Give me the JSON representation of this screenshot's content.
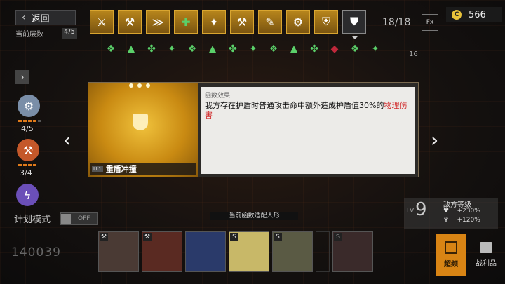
{
  "header": {
    "back_label": "返回",
    "floor_label": "当前层数",
    "floor_value": "4/5",
    "item_count": "18/18",
    "fx_label": "Fx",
    "currency_symbol": "C",
    "currency_value": "566"
  },
  "items": [
    {
      "icon": "slash-knight-icon"
    },
    {
      "icon": "axe-icon"
    },
    {
      "icon": "dash-icon"
    },
    {
      "icon": "green-cross-icon"
    },
    {
      "icon": "spark-badge-icon"
    },
    {
      "icon": "hammer-icon"
    },
    {
      "icon": "wrench-icon"
    },
    {
      "icon": "tools-icon"
    },
    {
      "icon": "shield-plus-icon"
    }
  ],
  "map_right_number": "16",
  "left_panel": {
    "skills": [
      {
        "icon": "gear-shock-icon",
        "count": "4/5",
        "color": "#7a8ea8"
      },
      {
        "icon": "hammer-strike-icon",
        "count": "3/4",
        "color": "#c4582a"
      },
      {
        "icon": "lightning-man-icon",
        "count": "",
        "color": "#6b4fb8"
      }
    ],
    "plan_label": "计划模式",
    "plan_toggle": "OFF",
    "score": "140039"
  },
  "card": {
    "name_tag": "ⅡL1",
    "name": "重盾冲撞",
    "effect_heading": "函数效果",
    "desc_main": "我方存在护盾时普通攻击命中额外造成护盾值30%的",
    "desc_highlight": "物理伤害"
  },
  "bottom": {
    "fit_label": "当前函数适配人形",
    "level_label": "LV",
    "level_value": "9",
    "enemy_level_label": "敌方等级",
    "hp_bonus": "+230%",
    "atk_bonus": "+120%",
    "turbo_label": "超频",
    "loot_label": "战利品"
  },
  "team": [
    {
      "badge": "⚒",
      "color": "#4a3a34"
    },
    {
      "badge": "⚒",
      "color": "#5a2a22"
    },
    {
      "badge": "",
      "color": "#2a3a6a"
    },
    {
      "badge": "S",
      "color": "#c8b868"
    },
    {
      "badge": "S",
      "color": "#5a5a44"
    },
    {
      "badge": "S",
      "color": "#3a2a2a"
    }
  ],
  "colors": {
    "accent": "#d88414",
    "highlight": "#d12a2a",
    "card_gold": "#e6b032"
  }
}
